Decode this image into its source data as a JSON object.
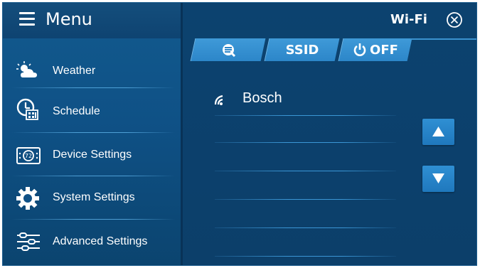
{
  "menu": {
    "title": "Menu",
    "items": [
      {
        "label": "Weather",
        "icon": "weather-icon"
      },
      {
        "label": "Schedule",
        "icon": "schedule-icon"
      },
      {
        "label": "Device Settings",
        "icon": "device-settings-icon"
      },
      {
        "label": "System Settings",
        "icon": "gear-icon"
      },
      {
        "label": "Advanced Settings",
        "icon": "sliders-icon"
      }
    ],
    "device_icon_text": "72"
  },
  "wifi": {
    "title": "Wi-Fi",
    "tabs": [
      {
        "label": "",
        "icon": "search-list-icon"
      },
      {
        "label": "SSID"
      },
      {
        "label": "OFF",
        "icon": "power-icon"
      }
    ],
    "networks": [
      {
        "name": "Bosch",
        "icon": "wifi-signal-icon"
      }
    ]
  },
  "colors": {
    "accent": "#2c86c9",
    "background": "#0c426f",
    "menu_background": "#0f5186",
    "text": "#ffffff"
  }
}
